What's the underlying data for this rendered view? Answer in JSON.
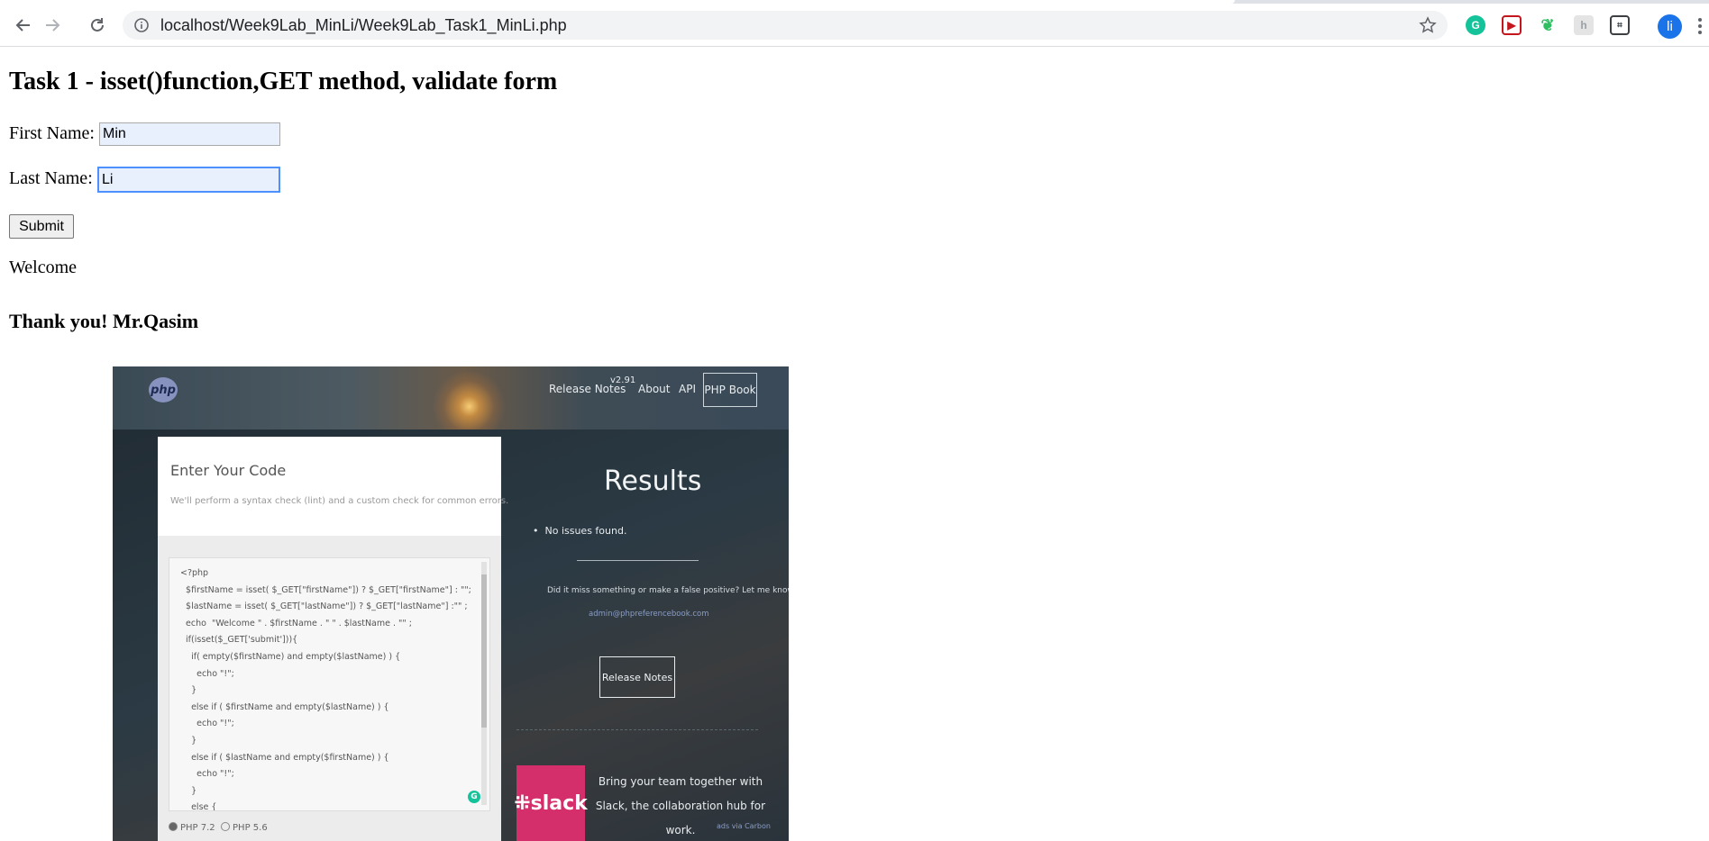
{
  "browser": {
    "url": "localhost/Week9Lab_MinLi/Week9Lab_Task1_MinLi.php",
    "profile_initial": "li"
  },
  "page": {
    "heading": "Task 1 - isset()function,GET method, validate form",
    "first_name_label": "First Name:",
    "first_name_value": "Min",
    "last_name_label": "Last Name:",
    "last_name_value": "Li",
    "submit_label": "Submit",
    "welcome_text": "Welcome",
    "thanks_text": "Thank you! Mr.Qasim"
  },
  "embedded_screenshot": {
    "logo": "php",
    "nav": {
      "release_notes": "Release Notes",
      "version": "v2.91",
      "about": "About",
      "api": "API",
      "php_book": "PHP Book"
    },
    "editor": {
      "title": "Enter Your Code",
      "subtitle": "We'll perform a syntax check (lint) and a custom check for common errors.",
      "code": "<?php\n  $firstName = isset( $_GET[\"firstName\"]) ? $_GET[\"firstName\"] : \"\";\n  $lastName = isset( $_GET[\"lastName\"]) ? $_GET[\"lastName\"] :\"\" ;\n  echo  \"Welcome \" . $firstName . \" \" . $lastName . \"\" ;\n  if(isset($_GET['submit'])){\n    if( empty($firstName) and empty($lastName) ) {\n      echo \"!\";\n    }\n    else if ( $firstName and empty($lastName) ) {\n      echo \"!\";\n    }\n    else if ( $lastName and empty($firstName) ) {\n      echo \"!\";\n    }\n    else {",
      "radio_1": "PHP 7.2",
      "radio_2": "PHP 5.6"
    },
    "results": {
      "title": "Results",
      "no_issues": "No issues found.",
      "miss_text": "Did it miss something or make a false positive? Let me know:",
      "email": "admin@phpreferencebook.com",
      "release_notes_button": "Release Notes"
    },
    "ad": {
      "logo_text": "slack",
      "text": "Bring your team together with Slack, the collaboration hub for work.",
      "via": "ads via Carbon"
    }
  },
  "colors": {
    "focus_border": "#4d90fe",
    "autofill_bg": "#e8f0fe",
    "profile_bg": "#1a73e8",
    "slack_bg": "#d42e6b"
  }
}
